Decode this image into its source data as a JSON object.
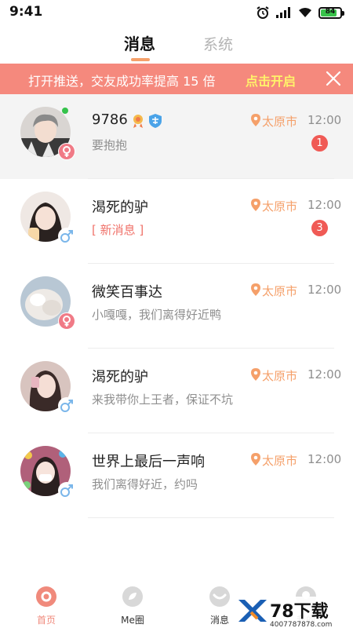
{
  "status_bar": {
    "time": "9:41",
    "battery_level": "84",
    "battery_fraction": 0.84
  },
  "tabs": [
    {
      "label": "消息",
      "active": true
    },
    {
      "label": "系统",
      "active": false
    }
  ],
  "banner": {
    "text": "打开推送，交友成功率提高 15 倍",
    "action": "点击开启"
  },
  "messages": [
    {
      "name": "9786",
      "preview": "要抱抱",
      "location": "太原市",
      "time": "12:00",
      "unread": "1",
      "gender": "female",
      "online": true
    },
    {
      "name": "渴死的驴",
      "preview": "[ 新消息 ]",
      "location": "太原市",
      "time": "12:00",
      "unread": "3",
      "gender": "male",
      "online": false
    },
    {
      "name": "微笑百事达",
      "preview": "小嘎嘎，我们离得好近鸭",
      "location": "太原市",
      "time": "12:00",
      "unread": "",
      "gender": "female",
      "online": false
    },
    {
      "name": "渴死的驴",
      "preview": "来我带你上王者，保证不坑",
      "location": "太原市",
      "time": "12:00",
      "unread": "",
      "gender": "male",
      "online": false
    },
    {
      "name": "世界上最后一声响",
      "preview": "我们离得好近，约吗",
      "location": "太原市",
      "time": "12:00",
      "unread": "",
      "gender": "male",
      "online": false
    }
  ],
  "bottom_nav": [
    {
      "label": "首页",
      "icon": "home-icon",
      "active": true
    },
    {
      "label": "Me圈",
      "icon": "me-circle-icon",
      "active": false
    },
    {
      "label": "消息",
      "icon": "message-icon",
      "active": false
    },
    {
      "label": "我的",
      "icon": "profile-icon",
      "active": false
    }
  ],
  "watermark": {
    "text": "78下载",
    "url": "4007787878.com"
  },
  "colors": {
    "accent": "#f5a06a",
    "banner_bg": "#f5897d",
    "banner_action": "#fff26a",
    "unread_badge": "#f05a55",
    "online": "#35c24b",
    "female": "#f07a86",
    "male": "#7ab6ea"
  }
}
